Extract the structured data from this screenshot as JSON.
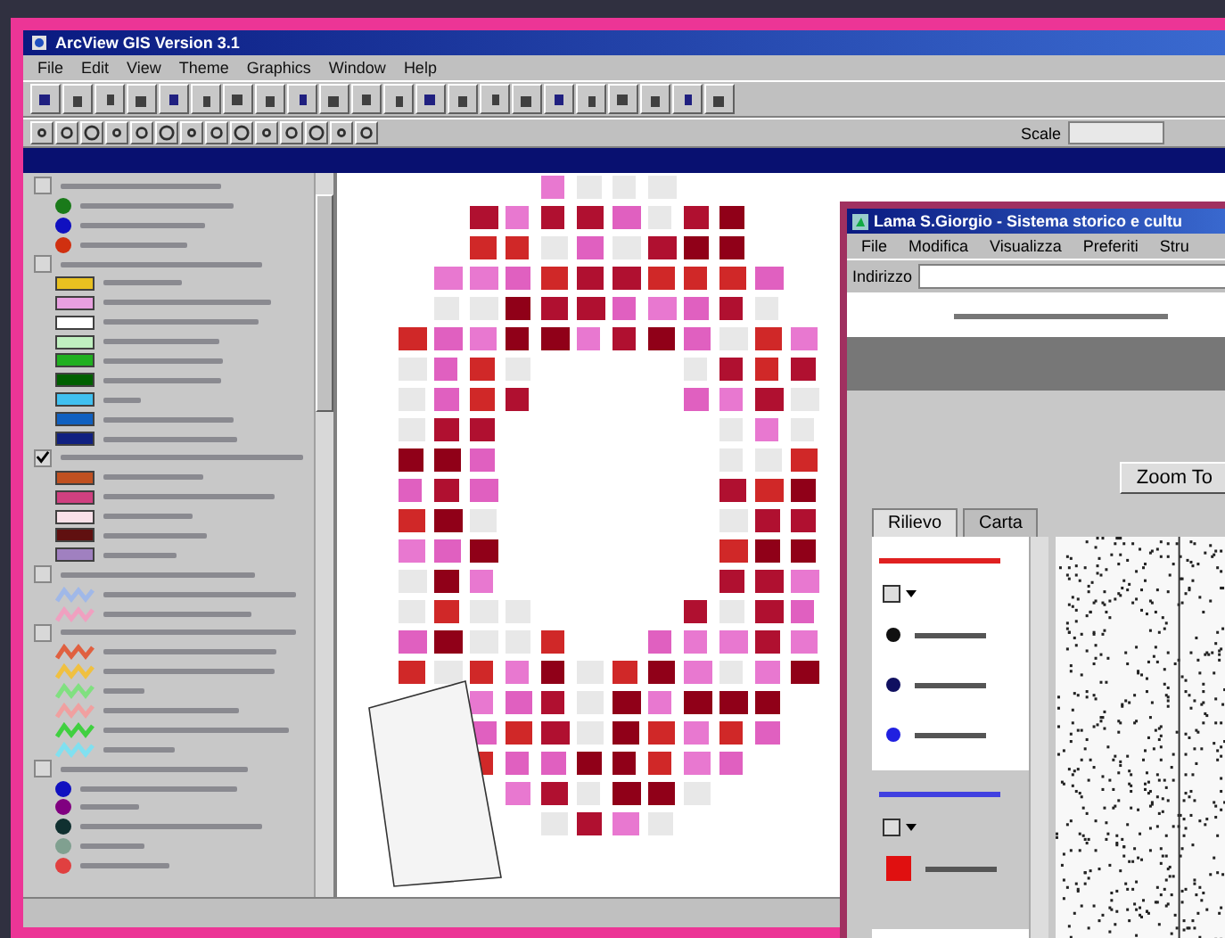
{
  "arcview": {
    "title": "ArcView GIS Version 3.1",
    "menus": [
      "File",
      "Edit",
      "View",
      "Theme",
      "Graphics",
      "Window",
      "Help"
    ],
    "scale_label": "Scale"
  },
  "legend": {
    "groups": [
      {
        "checked": false,
        "entries": [
          {
            "kind": "dot",
            "color": "#1a7a1a"
          },
          {
            "kind": "dot",
            "color": "#1010c0"
          },
          {
            "kind": "dot",
            "color": "#d03010"
          }
        ]
      },
      {
        "checked": false,
        "entries": [
          {
            "kind": "swatch",
            "color": "#e8c020"
          },
          {
            "kind": "swatch",
            "color": "#e8a0e0"
          },
          {
            "kind": "swatch",
            "color": "#ffffff"
          },
          {
            "kind": "swatch",
            "color": "#c0f0c0"
          },
          {
            "kind": "swatch",
            "color": "#20b020"
          },
          {
            "kind": "swatch",
            "color": "#006000"
          },
          {
            "kind": "swatch",
            "color": "#40c0f0"
          },
          {
            "kind": "swatch",
            "color": "#1060c0"
          },
          {
            "kind": "swatch",
            "color": "#102080"
          }
        ]
      },
      {
        "checked": true,
        "entries": [
          {
            "kind": "swatch",
            "color": "#c05020"
          },
          {
            "kind": "swatch",
            "color": "#d04080"
          },
          {
            "kind": "swatch",
            "color": "#f8e0e8"
          },
          {
            "kind": "swatch",
            "color": "#601010"
          },
          {
            "kind": "swatch",
            "color": "#a080c0"
          }
        ]
      },
      {
        "checked": false,
        "entries": [
          {
            "kind": "hatch",
            "color": "#a0b8e8"
          },
          {
            "kind": "hatch",
            "color": "#f0a0c0"
          }
        ]
      },
      {
        "checked": false,
        "entries": [
          {
            "kind": "hatch",
            "color": "#e06040"
          },
          {
            "kind": "hatch",
            "color": "#f0c040"
          },
          {
            "kind": "hatch",
            "color": "#80e080"
          },
          {
            "kind": "hatch",
            "color": "#f0a0a0"
          },
          {
            "kind": "hatch",
            "color": "#40d040"
          },
          {
            "kind": "hatch",
            "color": "#80e0f0"
          }
        ]
      },
      {
        "checked": false,
        "entries": [
          {
            "kind": "dot",
            "color": "#1010c0"
          },
          {
            "kind": "dot",
            "color": "#800080"
          },
          {
            "kind": "dot",
            "color": "#103030"
          },
          {
            "kind": "dot",
            "color": "#80a090"
          },
          {
            "kind": "dot",
            "color": "#e04040"
          }
        ]
      }
    ]
  },
  "browser": {
    "title": "Lama S.Giorgio - Sistema storico e cultu",
    "menus": [
      "File",
      "Modifica",
      "Visualizza",
      "Preferiti",
      "Stru"
    ],
    "address_label": "Indirizzo",
    "zoom_button": "Zoom To",
    "tabs": [
      {
        "label": "Rilievo",
        "selected": true
      },
      {
        "label": "Carta",
        "selected": false
      }
    ],
    "layers": [
      {
        "kind": "dot",
        "color": "#101010"
      },
      {
        "kind": "dot",
        "color": "#101060"
      },
      {
        "kind": "dot",
        "color": "#2020e0"
      }
    ],
    "second_layers": [
      {
        "kind": "swatch",
        "color": "#e01010"
      }
    ]
  }
}
